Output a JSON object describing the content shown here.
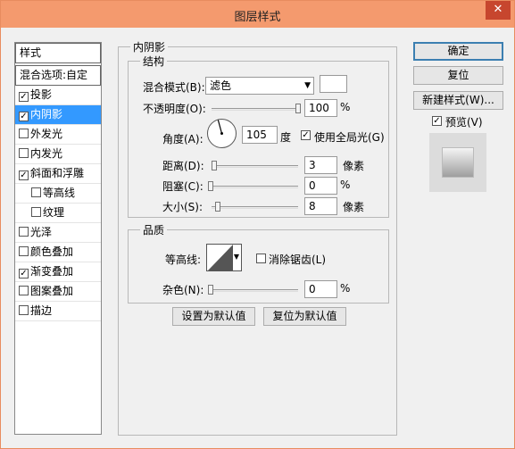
{
  "window": {
    "title": "图层样式",
    "close_glyph": "✕"
  },
  "sidebar": {
    "header": "样式",
    "blend_options": "混合选项:自定",
    "items": [
      {
        "label": "投影",
        "checked": true
      },
      {
        "label": "内阴影",
        "checked": true
      },
      {
        "label": "外发光",
        "checked": false
      },
      {
        "label": "内发光",
        "checked": false
      },
      {
        "label": "斜面和浮雕",
        "checked": true
      },
      {
        "label": "等高线",
        "checked": false
      },
      {
        "label": "纹理",
        "checked": false
      },
      {
        "label": "光泽",
        "checked": false
      },
      {
        "label": "颜色叠加",
        "checked": false
      },
      {
        "label": "渐变叠加",
        "checked": true
      },
      {
        "label": "图案叠加",
        "checked": false
      },
      {
        "label": "描边",
        "checked": false
      }
    ]
  },
  "panel": {
    "title": "内阴影",
    "structure": {
      "title": "结构",
      "blend_mode_label": "混合模式(B):",
      "blend_mode_value": "滤色",
      "opacity_label": "不透明度(O):",
      "opacity_value": "100",
      "opacity_unit": "%",
      "angle_label": "角度(A):",
      "angle_value": "105",
      "angle_unit": "度",
      "global_light_label": "使用全局光(G)",
      "global_light_checked": true,
      "distance_label": "距离(D):",
      "distance_value": "3",
      "distance_unit": "像素",
      "choke_label": "阻塞(C):",
      "choke_value": "0",
      "choke_unit": "%",
      "size_label": "大小(S):",
      "size_value": "8",
      "size_unit": "像素"
    },
    "quality": {
      "title": "品质",
      "contour_label": "等高线:",
      "antialias_label": "消除锯齿(L)",
      "antialias_checked": false,
      "noise_label": "杂色(N):",
      "noise_value": "0",
      "noise_unit": "%"
    },
    "set_default": "设置为默认值",
    "reset_default": "复位为默认值"
  },
  "buttons": {
    "ok": "确定",
    "reset": "复位",
    "new_style": "新建样式(W)...",
    "preview_label": "预览(V)",
    "preview_checked": true
  },
  "colors": {
    "titlebar": "#f49a6e",
    "close_button": "#c7462e",
    "selected_item": "#3399ff"
  }
}
